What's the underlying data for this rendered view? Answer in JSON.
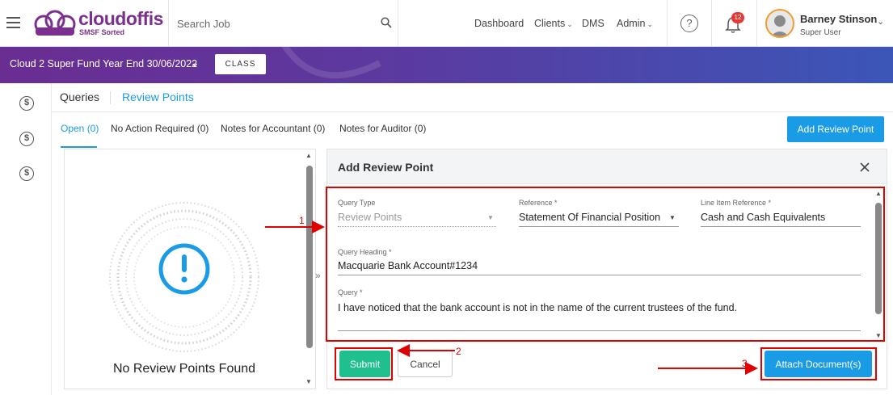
{
  "header": {
    "logo": "cloudoffis",
    "logo_sub": "SMSF Sorted",
    "search_placeholder": "Search Job",
    "nav": [
      "Dashboard",
      "Clients",
      "DMS",
      "Admin"
    ],
    "notification_count": "12",
    "user_name": "Barney Stinson",
    "user_role": "Super User",
    "brand_color": "#7b2f8e"
  },
  "job_bar": {
    "title": "Cloud 2 Super Fund Year End 30/06/2022",
    "class_logo": "CLASS"
  },
  "tabs": {
    "main": [
      "Queries",
      "Review Points"
    ],
    "sub": [
      "Open (0)",
      "No Action Required (0)",
      "Notes for Accountant (0)",
      "Notes for Auditor (0)"
    ],
    "add_button": "Add Review Point"
  },
  "empty_state": {
    "message": "No Review Points Found",
    "icon": "exclamation-icon"
  },
  "dialog": {
    "title": "Add Review Point",
    "fields": {
      "query_type_label": "Query Type",
      "query_type_value": "Review Points",
      "reference_label": "Reference *",
      "reference_value": "Statement Of Financial Position",
      "line_item_label": "Line Item Reference *",
      "line_item_value": "Cash and Cash Equivalents",
      "heading_label": "Query Heading *",
      "heading_value": "Macquarie Bank Account#1234",
      "query_label": "Query *",
      "query_value": "I have noticed that the bank account is not in the name of the current trustees of the fund."
    },
    "submit": "Submit",
    "cancel": "Cancel",
    "attach": "Attach Document(s)"
  },
  "annotations": [
    "1",
    "2",
    "3"
  ],
  "colors": {
    "accent": "#1a9be6",
    "submit": "#1fc08e",
    "annotation": "#e00000"
  }
}
